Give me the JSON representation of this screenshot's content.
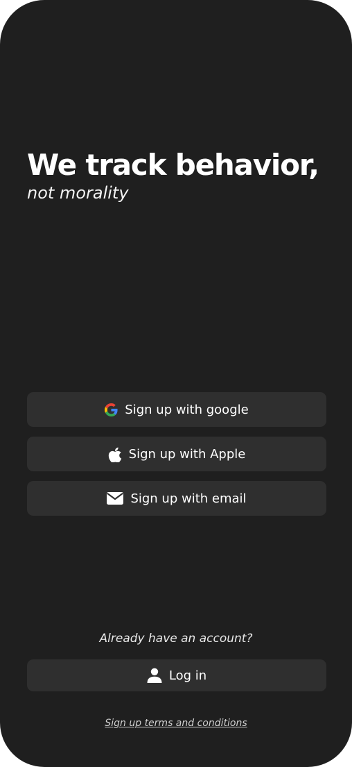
{
  "hero": {
    "title": "We track behavior,",
    "subtitle": "not morality"
  },
  "signup": {
    "google_label": "Sign up with google",
    "apple_label": "Sign up with Apple",
    "email_label": "Sign up with email"
  },
  "login": {
    "prompt": "Already have an account?",
    "button_label": "Log in"
  },
  "footer": {
    "terms_link": "Sign up terms and conditions"
  },
  "icons": {
    "google": "google-icon",
    "apple": "apple-icon",
    "email": "mail-icon",
    "user": "user-icon"
  },
  "colors": {
    "background": "#1f1f1f",
    "button": "#2f2f2f",
    "text": "#ffffff",
    "google_blue": "#4285F4",
    "google_red": "#EA4335",
    "google_yellow": "#FBBC05",
    "google_green": "#34A853"
  }
}
